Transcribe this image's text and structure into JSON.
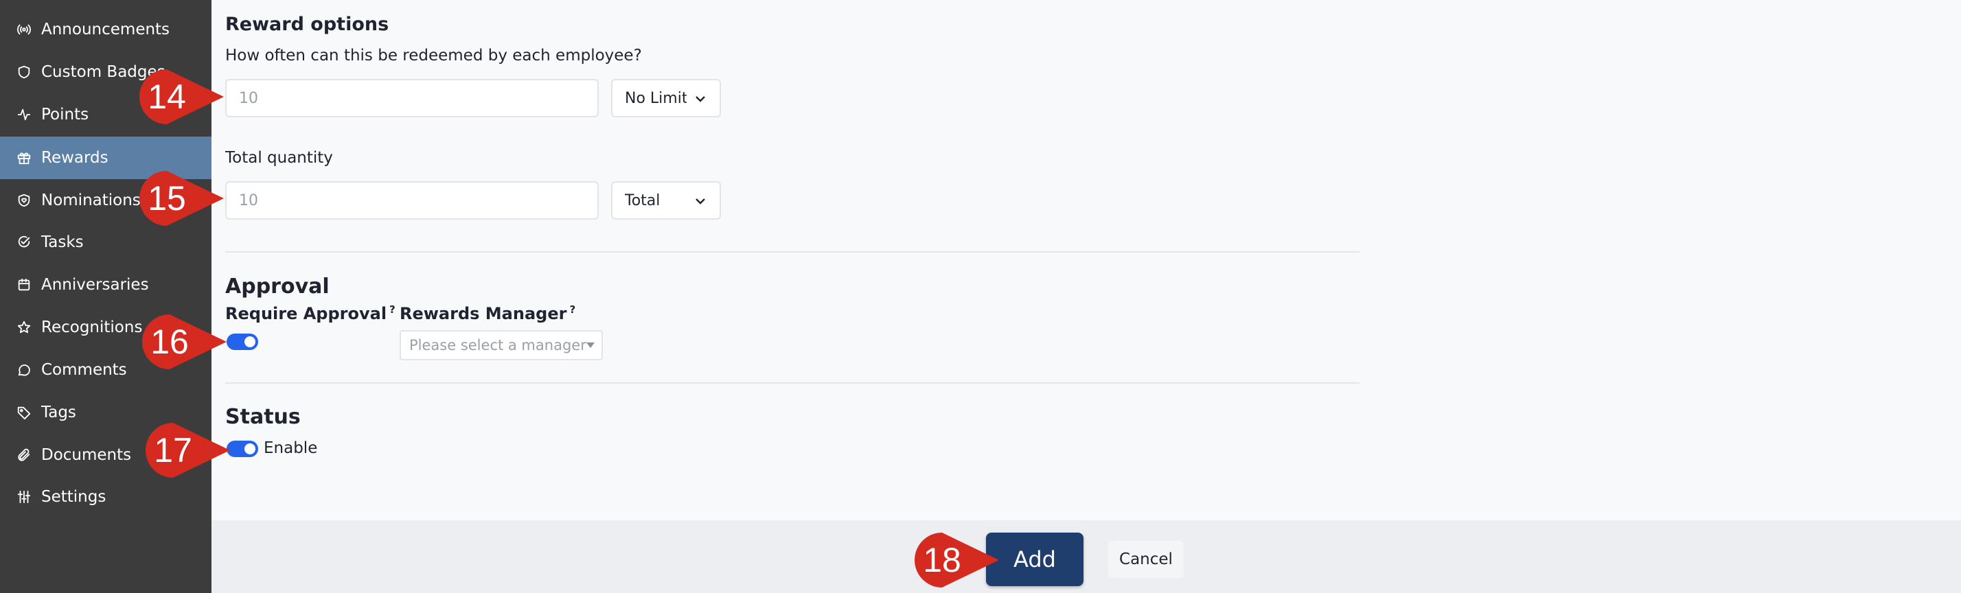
{
  "sidebar": {
    "items": [
      {
        "label": "Announcements",
        "icon": "broadcast-icon",
        "active": false
      },
      {
        "label": "Custom Badges",
        "icon": "shield-icon",
        "active": false
      },
      {
        "label": "Points",
        "icon": "activity-icon",
        "active": false
      },
      {
        "label": "Rewards",
        "icon": "gift-icon",
        "active": true
      },
      {
        "label": "Nominations",
        "icon": "heart-shield-icon",
        "active": false
      },
      {
        "label": "Tasks",
        "icon": "check-circle-icon",
        "active": false
      },
      {
        "label": "Anniversaries",
        "icon": "calendar-icon",
        "active": false
      },
      {
        "label": "Recognitions",
        "icon": "star-icon",
        "active": false
      },
      {
        "label": "Comments",
        "icon": "chat-bubble-icon",
        "active": false
      },
      {
        "label": "Tags",
        "icon": "tag-icon",
        "active": false
      },
      {
        "label": "Documents",
        "icon": "paperclip-icon",
        "active": false
      },
      {
        "label": "Settings",
        "icon": "sliders-icon",
        "active": false
      }
    ]
  },
  "reward_options": {
    "title": "Reward options",
    "redeem_question": "How often can this be redeemed by each employee?",
    "redeem_placeholder": "10",
    "redeem_select": "No Limit",
    "total_quantity_label": "Total quantity",
    "total_placeholder": "10",
    "total_select": "Total"
  },
  "approval": {
    "title": "Approval",
    "require_label": "Require Approval",
    "require_help": "?",
    "manager_label": "Rewards Manager",
    "manager_help": "?",
    "manager_placeholder": "Please select a manager",
    "require_on": true
  },
  "status": {
    "title": "Status",
    "enable_label": "Enable",
    "enabled": true
  },
  "footer": {
    "add_label": "Add",
    "cancel_label": "Cancel"
  },
  "markers": [
    "14",
    "15",
    "16",
    "17",
    "18"
  ],
  "colors": {
    "sidebar_bg": "#3c3c3c",
    "sidebar_active": "#5c7fa6",
    "toggle_on": "#2563eb",
    "primary_button": "#1f3d6d",
    "marker_red": "#d42a1f"
  }
}
